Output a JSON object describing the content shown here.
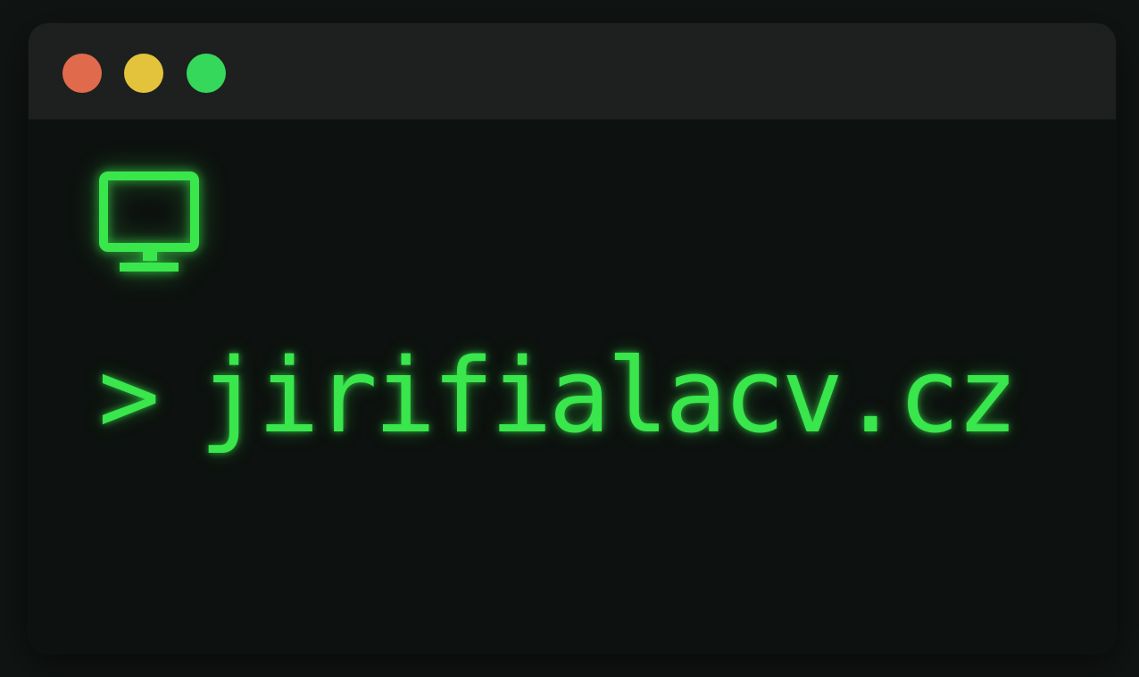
{
  "window": {
    "controls": [
      {
        "name": "close",
        "color": "#e06a4c"
      },
      {
        "name": "minimize",
        "color": "#e3c33b"
      },
      {
        "name": "maximize",
        "color": "#35d85a"
      }
    ]
  },
  "terminal": {
    "icon": "monitor-icon",
    "prompt_symbol": ">",
    "command": "jirifialacv.cz"
  },
  "colors": {
    "accent": "#39e64c",
    "background": "#0d110f",
    "titlebar": "#1d201f"
  }
}
